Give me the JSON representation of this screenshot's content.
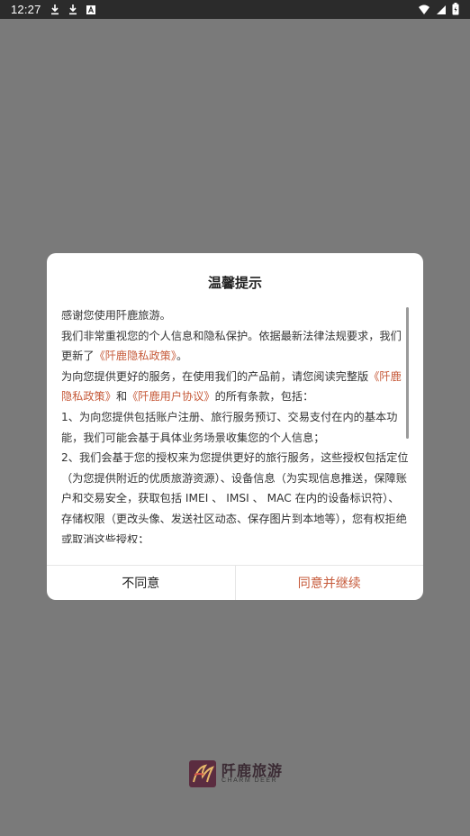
{
  "status_bar": {
    "time": "12:27",
    "icons_left": [
      "download-icon",
      "download-icon",
      "a-box-icon"
    ],
    "icons_right": [
      "wifi-icon",
      "signal-icon",
      "battery-icon"
    ]
  },
  "background_logo": {
    "title": "阡鹿旅游",
    "subtitle": "CHARM DEER"
  },
  "dialog": {
    "title": "温馨提示",
    "paragraphs": [
      "感谢您使用阡鹿旅游。",
      {
        "before": "我们非常重视您的个人信息和隐私保护。依据最新法律法规要求，我们更新了",
        "link": "《阡鹿隐私政策》",
        "after": "。"
      },
      {
        "before": "为向您提供更好的服务，在使用我们的产品前，请您阅读完整版",
        "link1": "《阡鹿隐私政策》",
        "middle": "和",
        "link2": "《阡鹿用户协议》",
        "after": "的所有条款，包括："
      },
      "1、为向您提供包括账户注册、旅行服务预订、交易支付在内的基本功能，我们可能会基于具体业务场景收集您的个人信息；",
      "2、我们会基于您的授权来为您提供更好的旅行服务，这些授权包括定位（为您提供附近的优质旅游资源）、设备信息（为实现信息推送，保障账户和交易安全，获取包括 IMEI 、 IMSI 、 MAC 在内的设备标识符）、存储权限（更改头像、发送社区动态、保存图片到本地等），您有权拒绝或取消这些授权；"
    ],
    "disagree_label": "不同意",
    "agree_label": "同意并继续"
  },
  "colors": {
    "overlay": "#7a7a7a",
    "link": "#c65a3a",
    "accent_button": "#c65a3a"
  }
}
